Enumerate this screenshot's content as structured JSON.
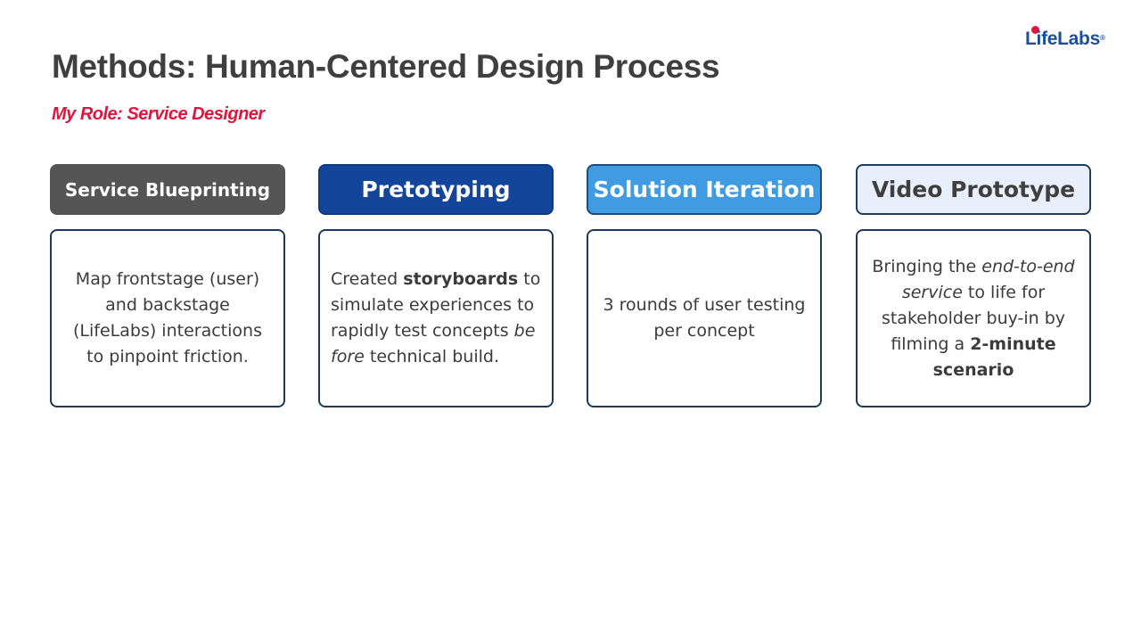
{
  "header": {
    "title": "Methods: Human-Centered Design Process",
    "subtitle": "My Role: Service Designer"
  },
  "logo": {
    "text_l": "L",
    "text_i": "i",
    "text_rest": "feLabs",
    "reg": "®",
    "brand_colors": {
      "blue": "#1b4f9c",
      "red": "#e0143c"
    }
  },
  "columns": [
    {
      "header": "Service Blueprinting",
      "header_color": "#555555",
      "body": {
        "t1": "Map frontstage (user) and backstage (LifeLabs) interactions to pinpoint friction."
      }
    },
    {
      "header": "Pretotyping",
      "header_color": "#13459b",
      "body": {
        "t1": "Created ",
        "b1": "storyboards",
        "t2": " to simulate experiences to rapidly test concepts ",
        "i1": "before",
        "t3": " technical build."
      }
    },
    {
      "header": "Solution Iteration",
      "header_color": "#419be0",
      "body": {
        "t1": "3 rounds of user testing per concept"
      }
    },
    {
      "header": "Video Prototype",
      "header_color": "#e8effb",
      "body": {
        "t1": "Bringing the ",
        "i1": "end-to-end service",
        "t2": " to life for stakeholder buy-in by filming a ",
        "b1": "2-minute scenario"
      }
    }
  ]
}
